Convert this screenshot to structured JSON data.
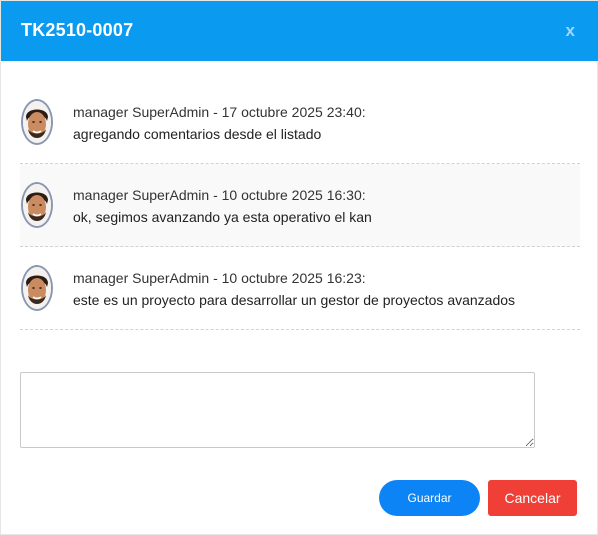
{
  "modal": {
    "title": "TK2510-0007",
    "close_label": "x"
  },
  "comments": [
    {
      "meta": "manager SuperAdmin - 17 octubre 2025 23:40:",
      "text": "agregando comentarios desde el listado"
    },
    {
      "meta": "manager SuperAdmin - 10 octubre 2025 16:30:",
      "text": "ok, segimos avanzando ya esta operativo el kan"
    },
    {
      "meta": "manager SuperAdmin - 10 octubre 2025 16:23:",
      "text": "este es un proyecto para desarrollar un gestor de proyectos avanzados"
    }
  ],
  "reply": {
    "value": ""
  },
  "buttons": {
    "save_label": "Guardar",
    "cancel_label": "Cancelar"
  },
  "colors": {
    "header": "#0a9af0",
    "save": "#0d84f5",
    "cancel": "#ef3f36"
  },
  "icons": {
    "avatar": "user-avatar-icon"
  }
}
